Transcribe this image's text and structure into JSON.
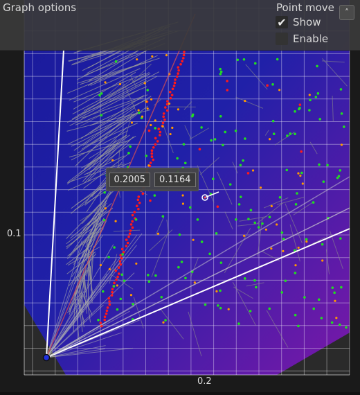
{
  "panel": {
    "title": "Graph options",
    "point_move_title": "Point move",
    "show_label": "Show",
    "show_checked": true,
    "enable_label": "Enable",
    "enable_checked": false,
    "collapse_icon": "chevron-double-up-icon"
  },
  "tooltip": {
    "x_value": "0.2005",
    "y_value": "0.1164"
  },
  "axis": {
    "y_tick": "0.1",
    "x_tick": "0.2"
  },
  "colors": {
    "bg_top": "#1a1a8a",
    "bg_bottom_right": "#7a1aa0",
    "grid": "#ffffff",
    "red_points": "#ff1a1a",
    "green_points": "#22dd22",
    "orange_points": "#ff9900"
  }
}
